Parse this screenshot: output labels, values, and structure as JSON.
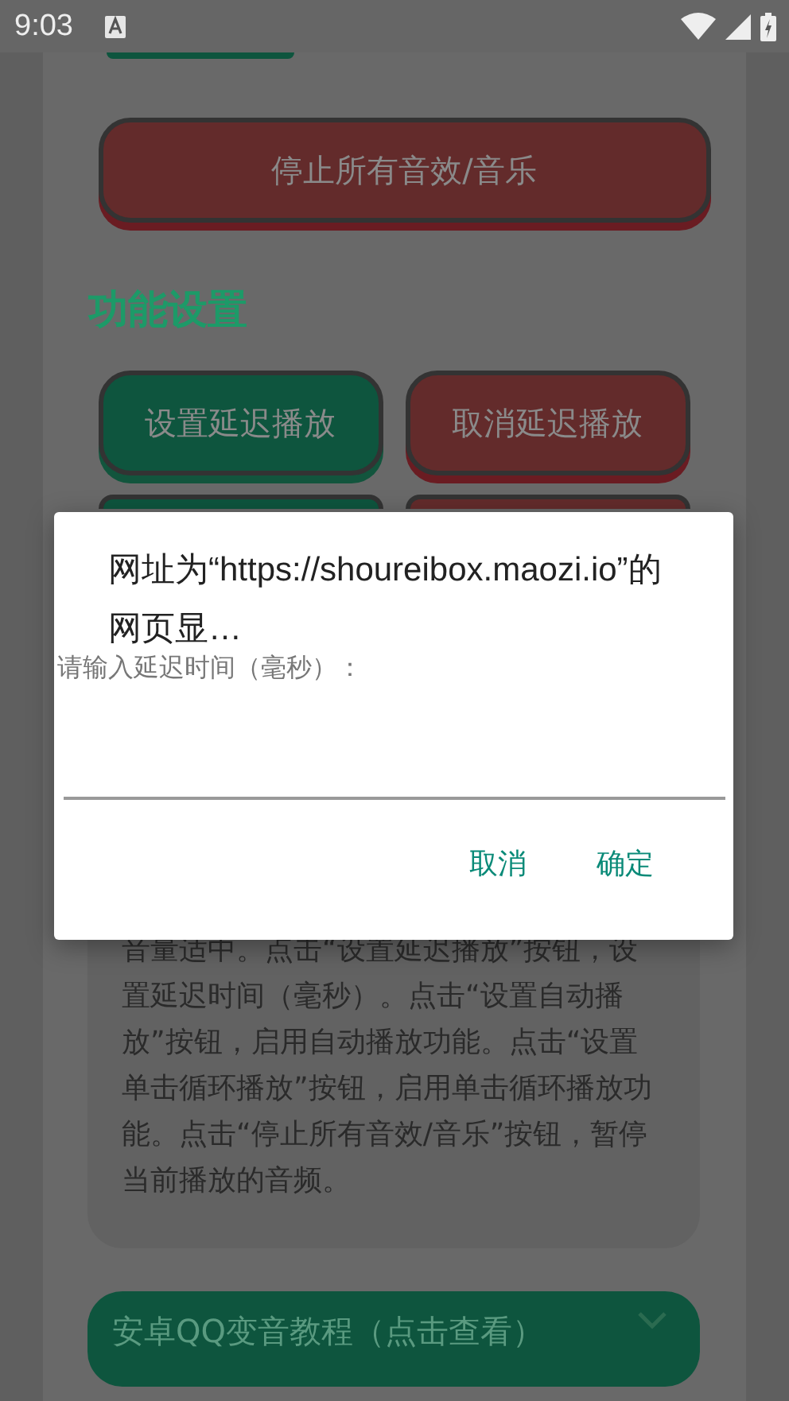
{
  "status_bar": {
    "time": "9:03"
  },
  "stop_button": {
    "label": "停止所有音效/音乐"
  },
  "section_title": "功能设置",
  "buttons": [
    {
      "label": "设置延迟播放",
      "kind": "go"
    },
    {
      "label": "取消延迟播放",
      "kind": "stop"
    }
  ],
  "hidden_buttons": [
    {
      "kind": "go"
    },
    {
      "kind": "stop"
    }
  ],
  "instructions": "音量适中。点击“设置延迟播放”按钮，设置延迟时间（毫秒）。点击“设置自动播放”按钮，启用自动播放功能。点击“设置单击循环播放”按钮，启用单击循环播放功能。点击“停止所有音效/音乐”按钮，暂停当前播放的音频。",
  "collapsible": {
    "title": "安卓QQ变音教程（点击查看）",
    "expanded": false
  },
  "dialog": {
    "title": "网址为“https://shoureibox.maozi.io”的网页显…",
    "message": "请输入延迟时间（毫秒）：",
    "buttons": [
      "取消",
      "确定"
    ]
  }
}
